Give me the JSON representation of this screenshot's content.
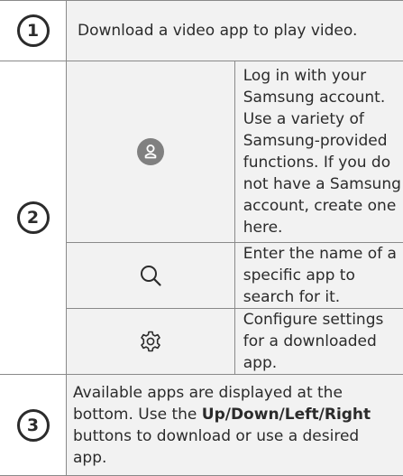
{
  "rows": [
    {
      "number": "1",
      "text": "Download a video app to play video."
    },
    {
      "number": "2",
      "items": [
        {
          "icon": "account-icon",
          "text": "Log in with your Samsung account. Use a variety of Samsung-provided functions. If you do not have a Samsung account, create one here."
        },
        {
          "icon": "search-icon",
          "text": "Enter the name of a specific app to search for it."
        },
        {
          "icon": "gear-icon",
          "text": "Configure settings for a downloaded app."
        }
      ]
    },
    {
      "number": "3",
      "text_before": "Available apps are displayed at the bottom. Use the ",
      "text_bold": "Up/Down/Left/Right",
      "text_after": " buttons to download or use a desired app."
    }
  ],
  "colors": {
    "badge": "#2b2b2b",
    "shade": "#f2f2f2",
    "border": "#8a8a8a",
    "icon": "#808080"
  }
}
